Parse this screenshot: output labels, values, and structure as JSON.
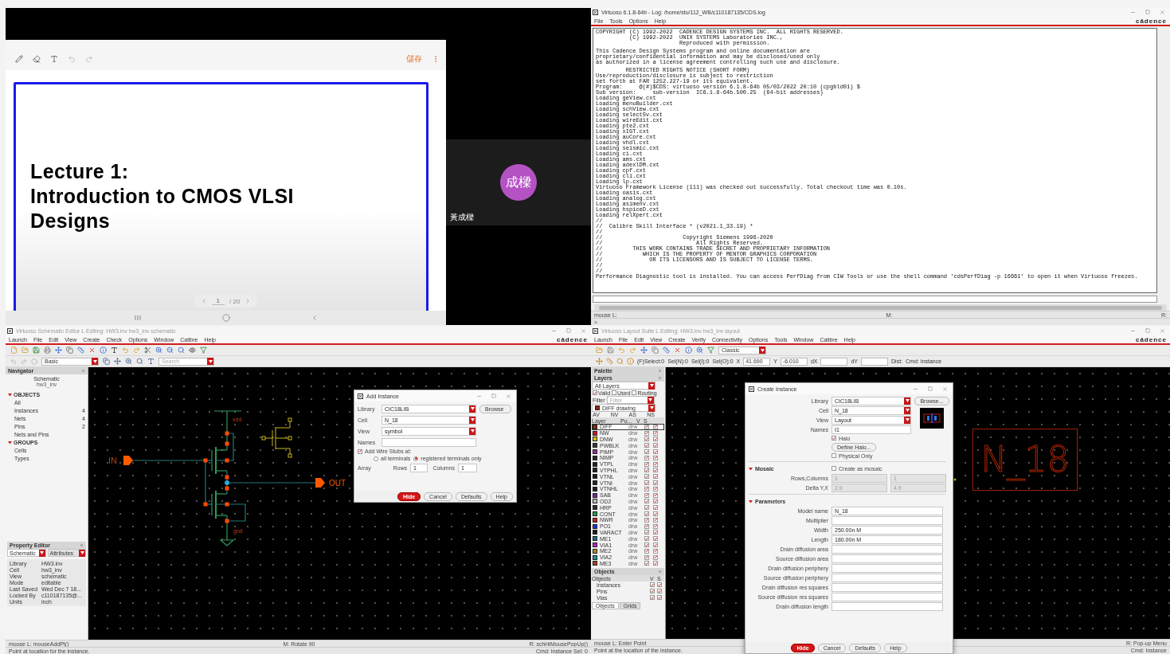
{
  "meeting": {
    "shared_screen": {
      "save_label": "儲存",
      "slide_title_lines": [
        "Lecture 1:",
        "Introduction to CMOS VLSI",
        "Designs"
      ],
      "pager": {
        "page": "1",
        "total": "/ 20"
      }
    },
    "participant": {
      "avatar_text": "成樑",
      "name": "黃成樑"
    }
  },
  "log_window": {
    "title": "Virtuoso 6.1.8-64b - Log: /home/stu/112_WB/c110187135/CDS.log",
    "menu": [
      "File",
      "Tools",
      "Options",
      "Help"
    ],
    "brand": "cādence",
    "log_blocks": [
      "COPYRIGHT (C) 1992-2022  CADENCE DESIGN SYSTEMS INC.  ALL RIGHTS RESERVED.\n          (C) 1992-2022  UNIX SYSTEMS Laboratories INC.,\n                         Reproduced with permission.",
      "This Cadence Design Systems program and online documentation are\nproprietary/confidential information and may be disclosed/used only\nas authorized in a license agreement controlling such use and disclosure.",
      "         RESTRICTED RIGHTS NOTICE (SHORT FORM)\nUse/reproduction/disclosure is subject to restriction\nset forth at FAR 1252.227-19 or its equivalent.\nProgram:     @(#)$CDS: virtuoso version 6.1.8-64b 05/03/2022 20:10 (cpgbld01) $\nSub version:     sub-version  IC6.1.8-64b.500.25  (64-bit addresses)\nLoading geView.cxt\nLoading menuBuilder.cxt\nLoading schView.cxt\nLoading selectSv.cxt\nLoading wireEdit.cxt\nLoading pte2.cxt\nLoading xIGT.cxt\nLoading auCore.cxt\nLoading vhdl.cxt\nLoading seismic.cxt\nLoading ci.cxt\nLoading ams.cxt\nLoading adexlDM.cxt\nLoading cpf.cxt\nLoading cli.cxt\nLoading lp.cxt\nVirtuoso Framework License (111) was checked out successfully. Total checkout time was 0.10s.\nLoading oasis.cxt\nLoading analog.cxt\nLoading asimenv.cxt\nLoading hspiceD.cxt\nLoading relXpert.cxt\n//\n//  Calibre Skill Interface * (v2021.1_33.19) *\n//\n//                        Copyright Siemens 1996-2020\n//                            All Rights Reserved.\n//         THIS WORK CONTAINS TRADE SECRET AND PROPRIETARY INFORMATION\n//            WHICH IS THE PROPERTY OF MENTOR GRAPHICS CORPORATION\n//              OR ITS LICENSORS AND IS SUBJECT TO LICENSE TERMS.\n//\n//\nPerformance Diagnostic tool is installed. You can access PerfDiag from CIW Tools or use the shell command 'cdsPerfDiag -p 16661' to open it when Virtuoso freezes."
    ],
    "status": {
      "left": "mouse L:",
      "middle": "M:",
      "right": "R:"
    },
    "prompt": ">"
  },
  "schematic_editor": {
    "title": "Virtuoso Schematic Editor L Editing: HW3.inv hw3_inv schematic",
    "menu": [
      "Launch",
      "File",
      "Edit",
      "View",
      "Create",
      "Check",
      "Options",
      "Window",
      "Calibre",
      "Help"
    ],
    "brand": "cādence",
    "mode": "Basic",
    "search_placeholder": "Search",
    "navigator": {
      "title": "Navigator",
      "heading": "Schematic",
      "cell": "hw3_inv",
      "sections": [
        {
          "label": "OBJECTS",
          "expanded": true,
          "items": [
            {
              "label": "All"
            },
            {
              "label": "Instances",
              "count": "4"
            },
            {
              "label": "Nets",
              "count": "4"
            },
            {
              "label": "Pins",
              "count": "2"
            },
            {
              "label": "Nets and Pins"
            }
          ]
        },
        {
          "label": "GROUPS",
          "expanded": true,
          "items": [
            {
              "label": "Cells"
            },
            {
              "label": "Types"
            }
          ]
        }
      ]
    },
    "property_editor": {
      "title": "Property Editor",
      "tabs": [
        {
          "label": "Schematic",
          "selected": true
        },
        {
          "label": "Attributes",
          "selected": false
        }
      ],
      "rows": [
        {
          "name": "Library",
          "value": "HW3.inv"
        },
        {
          "name": "Cell",
          "value": "hw3_inv"
        },
        {
          "name": "View",
          "value": "schematic"
        },
        {
          "name": "Mode",
          "value": "editable"
        },
        {
          "name": "Last Saved",
          "value": "Wed Dec  7 18..."
        },
        {
          "name": "Locked By",
          "value": "c110187135@..."
        },
        {
          "name": "Units",
          "value": "inch"
        }
      ]
    },
    "canvas": {
      "in_label": "IN",
      "out_label": "OUT",
      "vdd_label": "vdd",
      "gnd_label": "gnd"
    },
    "dialog": {
      "title": "Add Instance",
      "fields": [
        {
          "label": "Library",
          "value": "CIC18LIB",
          "kind": "dropdown"
        },
        {
          "label": "Cell",
          "value": "N_18",
          "kind": "dropdown"
        },
        {
          "label": "View",
          "value": "symbol",
          "kind": "dropdown"
        },
        {
          "label": "Names",
          "kind": "text"
        }
      ],
      "browse": "Browse",
      "wire_stubs": {
        "label": "Add Wire Stubs at:",
        "checked": true
      },
      "terminal_options": [
        {
          "label": "all terminals",
          "selected": false
        },
        {
          "label": "registered terminals only",
          "selected": true
        }
      ],
      "array": {
        "label": "Array",
        "rows_label": "Rows",
        "rows": "1",
        "columns_label": "Columns",
        "columns": "1"
      },
      "buttons": [
        {
          "label": "Hide",
          "primary": true
        },
        {
          "label": "Cancel",
          "primary": false
        },
        {
          "label": "Defaults",
          "primary": false
        },
        {
          "label": "Help",
          "primary": false
        }
      ]
    },
    "status": {
      "left": "mouse L: mouseAddPt()",
      "middle": "M: Rotate 90",
      "right": "R: schHiMousePopUp()"
    },
    "prompt": "Point at location for the instance.",
    "command": "Cmd: Instance Sel: 0"
  },
  "layout_editor": {
    "title": "Virtuoso Layout Suite L Editing: HW3.inv hw3_inv layout",
    "menu": [
      "Launch",
      "File",
      "Edit",
      "View",
      "Create",
      "Verify",
      "Connectivity",
      "Options",
      "Tools",
      "Window",
      "Calibre",
      "Help"
    ],
    "brand": "cādence",
    "mode": "Classic",
    "selection": [
      "(F)Select:0",
      "Sel(N):0",
      "Sel(I):0",
      "Sel(O):0"
    ],
    "coords": [
      {
        "label": "X",
        "value": "41.690"
      },
      {
        "label": "Y",
        "value": "-6.010"
      },
      {
        "label": "dX"
      },
      {
        "label": "dY"
      }
    ],
    "dist": "Dist:",
    "command_mode": "Cmd: Instance",
    "palette": {
      "title": "Palette",
      "layers_title": "Layers",
      "layer_set": "All Layers",
      "filters": [
        {
          "label": "Valid",
          "checked": true
        },
        {
          "label": "Used",
          "checked": false
        },
        {
          "label": "Routing",
          "checked": false
        }
      ],
      "filter_label": "Filter",
      "filter_placeholder": "Filter",
      "current_layer": "DIFF drawing",
      "visibility_buttons": [
        "AV",
        "NV",
        "AS",
        "NS"
      ],
      "columns": [
        "Layer",
        "Pu...",
        "V",
        "S"
      ],
      "layers": [
        {
          "name": "DIFF",
          "purpose": "drw",
          "color": "#8b2a10",
          "visible": true,
          "selectable": true,
          "selected": true
        },
        {
          "name": "NW",
          "purpose": "drw",
          "color": "#c82020",
          "visible": true,
          "selectable": true,
          "selected": false
        },
        {
          "name": "DNW",
          "purpose": "drw",
          "color": "#e0c000",
          "visible": true,
          "selectable": true,
          "selected": false
        },
        {
          "name": "PWBLK",
          "purpose": "drw",
          "color": "#3a3a3a",
          "visible": true,
          "selectable": true,
          "selected": false
        },
        {
          "name": "PIMP",
          "purpose": "drw",
          "color": "#9a2aa8",
          "visible": true,
          "selectable": true,
          "selected": false
        },
        {
          "name": "NIMP",
          "purpose": "drw",
          "color": "#2a2a2a",
          "visible": true,
          "selectable": true,
          "selected": false
        },
        {
          "name": "VTPL",
          "purpose": "drw",
          "color": "#222222",
          "visible": true,
          "selectable": true,
          "selected": false
        },
        {
          "name": "VTPHL",
          "purpose": "drw",
          "color": "#262626",
          "visible": true,
          "selectable": true,
          "selected": false
        },
        {
          "name": "VTNL",
          "purpose": "drw",
          "color": "#1e1e1e",
          "visible": true,
          "selectable": true,
          "selected": false
        },
        {
          "name": "VTNI",
          "purpose": "drw",
          "color": "#242424",
          "visible": true,
          "selectable": true,
          "selected": false
        },
        {
          "name": "VTNHL",
          "purpose": "drw",
          "color": "#202020",
          "visible": true,
          "selectable": true,
          "selected": false
        },
        {
          "name": "SAB",
          "purpose": "drw",
          "color": "#7a22a0",
          "visible": true,
          "selectable": true,
          "selected": false
        },
        {
          "name": "OD2",
          "purpose": "drw",
          "color": "#bdbdbd",
          "visible": true,
          "selectable": true,
          "selected": false
        },
        {
          "name": "HRP",
          "purpose": "drw",
          "color": "#303030",
          "visible": true,
          "selectable": true,
          "selected": false
        },
        {
          "name": "CONT",
          "purpose": "drw",
          "color": "#20a040",
          "visible": true,
          "selectable": true,
          "selected": false
        },
        {
          "name": "NWR",
          "purpose": "drw",
          "color": "#d02020",
          "visible": true,
          "selectable": true,
          "selected": false
        },
        {
          "name": "PO1",
          "purpose": "drw",
          "color": "#2030d0",
          "visible": true,
          "selectable": true,
          "selected": false
        },
        {
          "name": "VARACT",
          "purpose": "drw",
          "color": "#1c1c1c",
          "visible": true,
          "selectable": true,
          "selected": false
        },
        {
          "name": "ME1",
          "purpose": "drw",
          "color": "#1a6b8a",
          "visible": true,
          "selectable": true,
          "selected": false
        },
        {
          "name": "VIA1",
          "purpose": "drw",
          "color": "#c020c0",
          "visible": true,
          "selectable": true,
          "selected": false
        },
        {
          "name": "ME2",
          "purpose": "drw",
          "color": "#a09020",
          "visible": true,
          "selectable": true,
          "selected": false
        },
        {
          "name": "VIA2",
          "purpose": "drw",
          "color": "#2090a0",
          "visible": true,
          "selectable": true,
          "selected": false
        },
        {
          "name": "ME3",
          "purpose": "drw",
          "color": "#b04010",
          "visible": true,
          "selectable": true,
          "selected": false
        }
      ],
      "objects_title": "Objects",
      "objects_columns": [
        "Objects",
        "V",
        "S"
      ],
      "objects": [
        {
          "name": "Instances",
          "visible": true,
          "selectable": true
        },
        {
          "name": "Pins",
          "visible": true,
          "selectable": true
        },
        {
          "name": "Vias",
          "visible": true,
          "selectable": true
        }
      ],
      "tabs": [
        {
          "label": "Objects",
          "selected": true
        },
        {
          "label": "Grids",
          "selected": false
        }
      ]
    },
    "canvas": {
      "instance_label": "N_18"
    },
    "dialog": {
      "title": "Create Instance",
      "fields": [
        {
          "label": "Library",
          "value": "CIC18LIB",
          "kind": "dropdown"
        },
        {
          "label": "Cell",
          "value": "N_18",
          "kind": "dropdown"
        },
        {
          "label": "View",
          "value": "Layout",
          "kind": "dropdown"
        },
        {
          "label": "Names",
          "value": "I1",
          "kind": "text"
        }
      ],
      "browse": "Browse...",
      "halo": {
        "label": "Halo",
        "checked": true
      },
      "define_halo": "Define Halo...",
      "physical_only": {
        "label": "Physical Only",
        "checked": false
      },
      "mosaic": {
        "label": "Mosaic",
        "expanded": true,
        "create": {
          "label": "Create as mosaic",
          "checked": false
        },
        "rows": [
          {
            "label": "Rows,Columns",
            "values": [
              "1",
              "1"
            ]
          },
          {
            "label": "Delta Y,X",
            "values": [
              "2.9",
              "4.9"
            ]
          }
        ]
      },
      "parameters": {
        "label": "Parameters",
        "expanded": true,
        "rows": [
          {
            "label": "Model name",
            "value": "N_18"
          },
          {
            "label": "Multiplier"
          },
          {
            "label": "Width",
            "value": "250.00n M"
          },
          {
            "label": "Length",
            "value": "180.00n M"
          },
          {
            "label": "Drain diffusion area"
          },
          {
            "label": "Source diffusion area"
          },
          {
            "label": "Drain diffusion periphery"
          },
          {
            "label": "Source diffusion periphery"
          },
          {
            "label": "Drain diffusion res squares"
          },
          {
            "label": "Source diffusion res squares"
          },
          {
            "label": "Drain diffusion length"
          }
        ]
      },
      "buttons": [
        {
          "label": "Hide",
          "primary": true
        },
        {
          "label": "Cancel",
          "primary": false
        },
        {
          "label": "Defaults",
          "primary": false
        },
        {
          "label": "Help",
          "primary": false
        }
      ]
    },
    "status": {
      "left": "mouse L: Enter Point",
      "right": "R: Pop-up Menu"
    },
    "prompt": "Point at the location of the instance.",
    "command": "Cmd: Instance"
  }
}
